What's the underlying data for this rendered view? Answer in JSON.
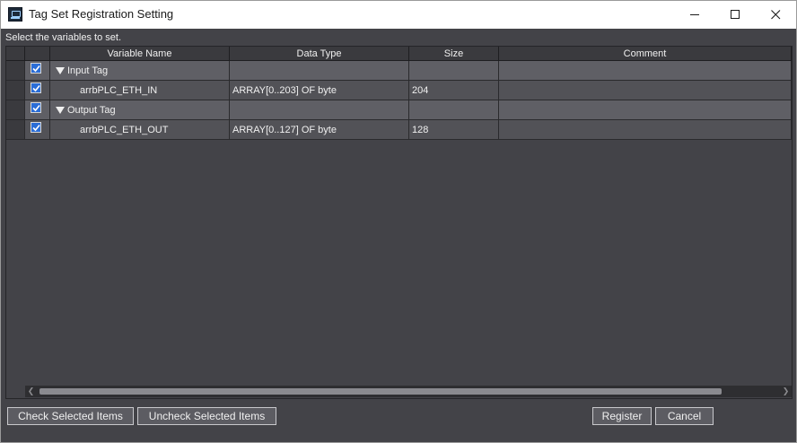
{
  "window": {
    "title": "Tag Set Registration Setting"
  },
  "hint": "Select the variables to set.",
  "columns": {
    "variable_name": "Variable Name",
    "data_type": "Data Type",
    "size": "Size",
    "comment": "Comment"
  },
  "rows": [
    {
      "kind": "group",
      "checked": true,
      "name": "Input Tag",
      "data_type": "",
      "size": "",
      "comment": ""
    },
    {
      "kind": "item",
      "checked": true,
      "name": "arrbPLC_ETH_IN",
      "data_type": "ARRAY[0..203] OF byte",
      "size": "204",
      "comment": ""
    },
    {
      "kind": "group",
      "checked": true,
      "name": "Output Tag",
      "data_type": "",
      "size": "",
      "comment": ""
    },
    {
      "kind": "item",
      "checked": true,
      "name": "arrbPLC_ETH_OUT",
      "data_type": "ARRAY[0..127] OF byte",
      "size": "128",
      "comment": ""
    }
  ],
  "buttons": {
    "check_selected": "Check Selected Items",
    "uncheck_selected": "Uncheck Selected Items",
    "register": "Register",
    "cancel": "Cancel"
  },
  "icons": {
    "app": "app-monitor-icon",
    "minimize": "minimize-icon",
    "maximize": "maximize-icon",
    "close": "close-icon",
    "expand": "triangle-down-icon",
    "checkbox": "checkbox-checked-icon"
  },
  "colors": {
    "background": "#434348",
    "group_row": "#5f5f65",
    "item_row": "#525257",
    "checkbox": "#2a6dd6"
  }
}
